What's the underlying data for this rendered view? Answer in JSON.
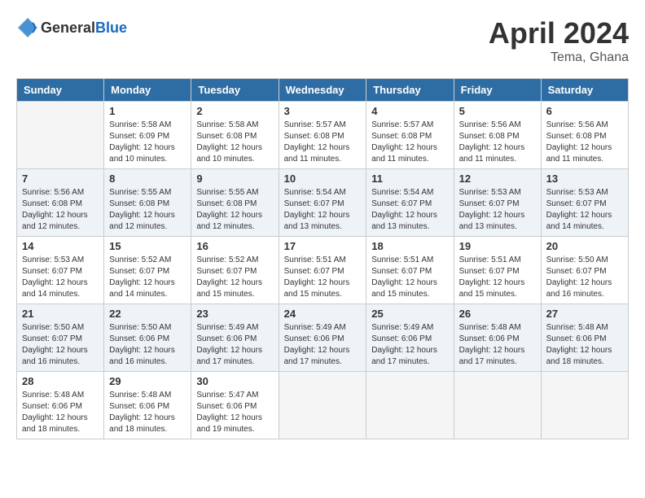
{
  "logo": {
    "text_general": "General",
    "text_blue": "Blue"
  },
  "title": {
    "month_year": "April 2024",
    "location": "Tema, Ghana"
  },
  "header_days": [
    "Sunday",
    "Monday",
    "Tuesday",
    "Wednesday",
    "Thursday",
    "Friday",
    "Saturday"
  ],
  "weeks": [
    [
      {
        "day": "",
        "sunrise": "",
        "sunset": "",
        "daylight": ""
      },
      {
        "day": "1",
        "sunrise": "Sunrise: 5:58 AM",
        "sunset": "Sunset: 6:09 PM",
        "daylight": "Daylight: 12 hours and 10 minutes."
      },
      {
        "day": "2",
        "sunrise": "Sunrise: 5:58 AM",
        "sunset": "Sunset: 6:08 PM",
        "daylight": "Daylight: 12 hours and 10 minutes."
      },
      {
        "day": "3",
        "sunrise": "Sunrise: 5:57 AM",
        "sunset": "Sunset: 6:08 PM",
        "daylight": "Daylight: 12 hours and 11 minutes."
      },
      {
        "day": "4",
        "sunrise": "Sunrise: 5:57 AM",
        "sunset": "Sunset: 6:08 PM",
        "daylight": "Daylight: 12 hours and 11 minutes."
      },
      {
        "day": "5",
        "sunrise": "Sunrise: 5:56 AM",
        "sunset": "Sunset: 6:08 PM",
        "daylight": "Daylight: 12 hours and 11 minutes."
      },
      {
        "day": "6",
        "sunrise": "Sunrise: 5:56 AM",
        "sunset": "Sunset: 6:08 PM",
        "daylight": "Daylight: 12 hours and 11 minutes."
      }
    ],
    [
      {
        "day": "7",
        "sunrise": "Sunrise: 5:56 AM",
        "sunset": "Sunset: 6:08 PM",
        "daylight": "Daylight: 12 hours and 12 minutes."
      },
      {
        "day": "8",
        "sunrise": "Sunrise: 5:55 AM",
        "sunset": "Sunset: 6:08 PM",
        "daylight": "Daylight: 12 hours and 12 minutes."
      },
      {
        "day": "9",
        "sunrise": "Sunrise: 5:55 AM",
        "sunset": "Sunset: 6:08 PM",
        "daylight": "Daylight: 12 hours and 12 minutes."
      },
      {
        "day": "10",
        "sunrise": "Sunrise: 5:54 AM",
        "sunset": "Sunset: 6:07 PM",
        "daylight": "Daylight: 12 hours and 13 minutes."
      },
      {
        "day": "11",
        "sunrise": "Sunrise: 5:54 AM",
        "sunset": "Sunset: 6:07 PM",
        "daylight": "Daylight: 12 hours and 13 minutes."
      },
      {
        "day": "12",
        "sunrise": "Sunrise: 5:53 AM",
        "sunset": "Sunset: 6:07 PM",
        "daylight": "Daylight: 12 hours and 13 minutes."
      },
      {
        "day": "13",
        "sunrise": "Sunrise: 5:53 AM",
        "sunset": "Sunset: 6:07 PM",
        "daylight": "Daylight: 12 hours and 14 minutes."
      }
    ],
    [
      {
        "day": "14",
        "sunrise": "Sunrise: 5:53 AM",
        "sunset": "Sunset: 6:07 PM",
        "daylight": "Daylight: 12 hours and 14 minutes."
      },
      {
        "day": "15",
        "sunrise": "Sunrise: 5:52 AM",
        "sunset": "Sunset: 6:07 PM",
        "daylight": "Daylight: 12 hours and 14 minutes."
      },
      {
        "day": "16",
        "sunrise": "Sunrise: 5:52 AM",
        "sunset": "Sunset: 6:07 PM",
        "daylight": "Daylight: 12 hours and 15 minutes."
      },
      {
        "day": "17",
        "sunrise": "Sunrise: 5:51 AM",
        "sunset": "Sunset: 6:07 PM",
        "daylight": "Daylight: 12 hours and 15 minutes."
      },
      {
        "day": "18",
        "sunrise": "Sunrise: 5:51 AM",
        "sunset": "Sunset: 6:07 PM",
        "daylight": "Daylight: 12 hours and 15 minutes."
      },
      {
        "day": "19",
        "sunrise": "Sunrise: 5:51 AM",
        "sunset": "Sunset: 6:07 PM",
        "daylight": "Daylight: 12 hours and 15 minutes."
      },
      {
        "day": "20",
        "sunrise": "Sunrise: 5:50 AM",
        "sunset": "Sunset: 6:07 PM",
        "daylight": "Daylight: 12 hours and 16 minutes."
      }
    ],
    [
      {
        "day": "21",
        "sunrise": "Sunrise: 5:50 AM",
        "sunset": "Sunset: 6:07 PM",
        "daylight": "Daylight: 12 hours and 16 minutes."
      },
      {
        "day": "22",
        "sunrise": "Sunrise: 5:50 AM",
        "sunset": "Sunset: 6:06 PM",
        "daylight": "Daylight: 12 hours and 16 minutes."
      },
      {
        "day": "23",
        "sunrise": "Sunrise: 5:49 AM",
        "sunset": "Sunset: 6:06 PM",
        "daylight": "Daylight: 12 hours and 17 minutes."
      },
      {
        "day": "24",
        "sunrise": "Sunrise: 5:49 AM",
        "sunset": "Sunset: 6:06 PM",
        "daylight": "Daylight: 12 hours and 17 minutes."
      },
      {
        "day": "25",
        "sunrise": "Sunrise: 5:49 AM",
        "sunset": "Sunset: 6:06 PM",
        "daylight": "Daylight: 12 hours and 17 minutes."
      },
      {
        "day": "26",
        "sunrise": "Sunrise: 5:48 AM",
        "sunset": "Sunset: 6:06 PM",
        "daylight": "Daylight: 12 hours and 17 minutes."
      },
      {
        "day": "27",
        "sunrise": "Sunrise: 5:48 AM",
        "sunset": "Sunset: 6:06 PM",
        "daylight": "Daylight: 12 hours and 18 minutes."
      }
    ],
    [
      {
        "day": "28",
        "sunrise": "Sunrise: 5:48 AM",
        "sunset": "Sunset: 6:06 PM",
        "daylight": "Daylight: 12 hours and 18 minutes."
      },
      {
        "day": "29",
        "sunrise": "Sunrise: 5:48 AM",
        "sunset": "Sunset: 6:06 PM",
        "daylight": "Daylight: 12 hours and 18 minutes."
      },
      {
        "day": "30",
        "sunrise": "Sunrise: 5:47 AM",
        "sunset": "Sunset: 6:06 PM",
        "daylight": "Daylight: 12 hours and 19 minutes."
      },
      {
        "day": "",
        "sunrise": "",
        "sunset": "",
        "daylight": ""
      },
      {
        "day": "",
        "sunrise": "",
        "sunset": "",
        "daylight": ""
      },
      {
        "day": "",
        "sunrise": "",
        "sunset": "",
        "daylight": ""
      },
      {
        "day": "",
        "sunrise": "",
        "sunset": "",
        "daylight": ""
      }
    ]
  ]
}
